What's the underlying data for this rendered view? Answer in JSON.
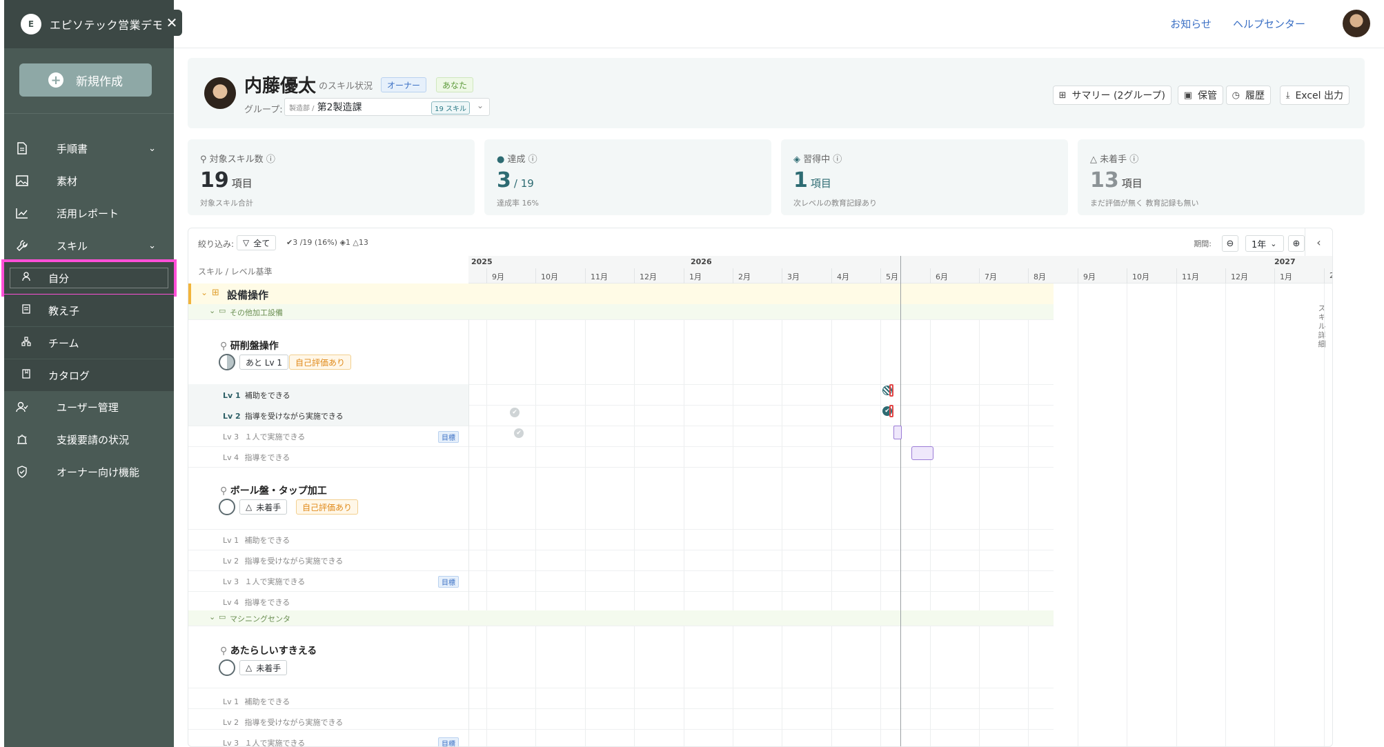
{
  "sidebar": {
    "app_name": "エピソテック営業デモ",
    "logo_text": "E",
    "close_glyph": "✕",
    "new_button": "新規作成",
    "items": [
      {
        "label": "手順書",
        "icon": "document-icon"
      },
      {
        "label": "素材",
        "icon": "image-icon"
      },
      {
        "label": "活用レポート",
        "icon": "chart-icon"
      },
      {
        "label": "スキル",
        "icon": "wrench-icon"
      }
    ],
    "skill_sub": [
      {
        "label": "自分",
        "icon": "person-icon"
      },
      {
        "label": "教え子",
        "icon": "student-icon"
      },
      {
        "label": "チーム",
        "icon": "team-icon"
      },
      {
        "label": "カタログ",
        "icon": "book-icon"
      }
    ],
    "bottom_items": [
      {
        "label": "ユーザー管理",
        "icon": "users-icon"
      },
      {
        "label": "支援要請の状況",
        "icon": "alarm-icon"
      },
      {
        "label": "オーナー向け機能",
        "icon": "shield-icon"
      }
    ]
  },
  "topbar": {
    "notice": "お知らせ",
    "help": "ヘルプセンター"
  },
  "profile": {
    "name": "内藤優太",
    "suffix": "のスキル状況",
    "badge_owner": "オーナー",
    "badge_you": "あなた",
    "group_label": "グループ:",
    "group_dept": "製造部 /",
    "group_value": "第2製造課",
    "group_count": "19 スキル",
    "buttons": {
      "summary": "サマリー (2グループ)",
      "save": "保管",
      "history": "履歴",
      "excel": "Excel 出力"
    }
  },
  "stats": [
    {
      "title": "対象スキル数",
      "value": "19",
      "unit": "項目",
      "sub": "対象スキル合計",
      "icon": "wrench-icon"
    },
    {
      "title": "達成",
      "value": "3",
      "unit": "/ 19",
      "sub": "達成率 16%",
      "icon": "check-circle-icon"
    },
    {
      "title": "習得中",
      "value": "1",
      "unit": "項目",
      "sub": "次レベルの教育記録あり",
      "icon": "striped-icon"
    },
    {
      "title": "未着手",
      "value": "13",
      "unit": "項目",
      "sub": "まだ評価が無く 教育記録も無い",
      "icon": "warning-icon"
    }
  ],
  "gantt": {
    "filter_label": "絞り込み:",
    "filter_all": "全て",
    "counts": "✔3 /19 (16%)  ◈1  △13",
    "period_label": "期間:",
    "period_value": "1年",
    "side_label": "スキル詳細",
    "left_header": "スキル / レベル基準",
    "years": [
      "2025",
      "2026",
      "2027"
    ],
    "months": [
      "9月",
      "10月",
      "11月",
      "12月",
      "1月",
      "2月",
      "3月",
      "4月",
      "5月",
      "6月",
      "7月",
      "8月",
      "9月",
      "10月",
      "11月",
      "12月",
      "1月",
      "2"
    ],
    "category": "設備操作",
    "groups": [
      {
        "name": "その他加工設備",
        "skills": [
          {
            "name": "研削盤操作",
            "chip": "あと Lv 1",
            "chip2": "自己評価あり",
            "levels": [
              {
                "lv": "Lv 1",
                "desc": "補助をできる"
              },
              {
                "lv": "Lv 2",
                "desc": "指導を受けながら実施できる"
              },
              {
                "lv": "Lv 3",
                "desc": "１人で実施できる",
                "goal": "目標"
              },
              {
                "lv": "Lv 4",
                "desc": "指導をできる"
              }
            ]
          },
          {
            "name": "ボール盤・タップ加工",
            "chip": "未着手",
            "chip2": "自己評価あり",
            "levels": [
              {
                "lv": "Lv 1",
                "desc": "補助をできる"
              },
              {
                "lv": "Lv 2",
                "desc": "指導を受けながら実施できる"
              },
              {
                "lv": "Lv 3",
                "desc": "１人で実施できる",
                "goal": "目標"
              },
              {
                "lv": "Lv 4",
                "desc": "指導をできる"
              }
            ]
          }
        ]
      },
      {
        "name": "マシニングセンタ",
        "skills": [
          {
            "name": "あたらしいすきえる",
            "chip": "未着手",
            "levels": [
              {
                "lv": "Lv 1",
                "desc": "補助をできる"
              },
              {
                "lv": "Lv 2",
                "desc": "指導を受けながら実施できる"
              },
              {
                "lv": "Lv 3",
                "desc": "１人で実施できる",
                "goal": "目標"
              }
            ]
          }
        ]
      }
    ]
  },
  "colors": {
    "sidebar_bg": "#4a5a55",
    "accent_link": "#3a6fc4",
    "highlight": "#ff4fd8",
    "category_bar": "#f2b43b",
    "teal": "#2d6b72"
  }
}
